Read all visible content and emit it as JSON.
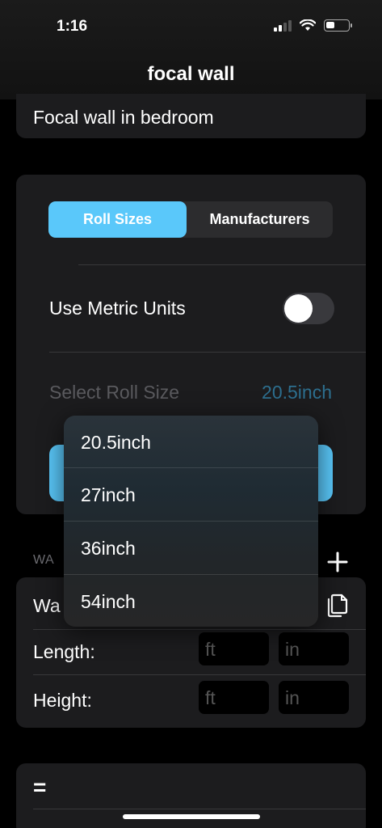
{
  "status_bar": {
    "time": "1:16"
  },
  "nav": {
    "title": "focal wall"
  },
  "project": {
    "name": "Focal wall in bedroom"
  },
  "settings": {
    "tabs": [
      {
        "label": "Roll Sizes",
        "selected": true
      },
      {
        "label": "Manufacturers",
        "selected": false
      }
    ],
    "metric_label": "Use Metric Units",
    "metric_enabled": false,
    "roll_size_label": "Select Roll Size",
    "roll_size_value": "20.5inch"
  },
  "walls": {
    "header": "WA",
    "wall_name": "Wa",
    "length_label": "Length:",
    "height_label": "Height:",
    "ft_placeholder": "ft",
    "in_placeholder": "in"
  },
  "bottom": {
    "symbol": "="
  },
  "roll_menu": {
    "options": [
      "20.5inch",
      "27inch",
      "36inch",
      "54inch"
    ]
  },
  "colors": {
    "accent": "#5ac8fa",
    "card": "#1c1c1e",
    "background": "#000000"
  }
}
